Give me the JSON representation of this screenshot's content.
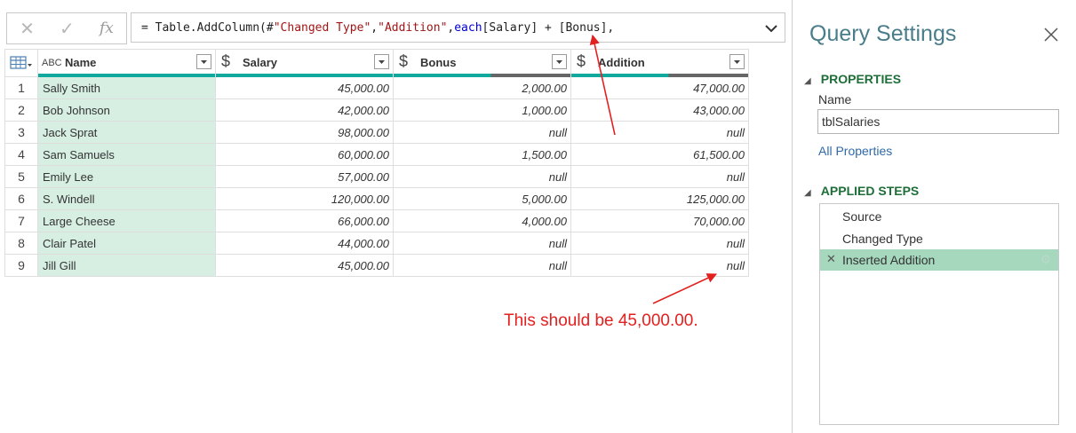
{
  "formula_bar": {
    "cancel_icon": "✕",
    "commit_icon": "✓",
    "fx_label": "fx",
    "parts": {
      "p1": "= Table.AddColumn(#",
      "p2": "\"Changed Type\"",
      "p3": ", ",
      "p4": "\"Addition\"",
      "p5": ", ",
      "p6": "each",
      "p7": " [Salary] + [Bonus],"
    }
  },
  "grid": {
    "columns": {
      "name": {
        "label": "Name",
        "type_icon": "ABC"
      },
      "salary": {
        "label": "Salary",
        "type_icon": "$"
      },
      "bonus": {
        "label": "Bonus",
        "type_icon": "$"
      },
      "addition": {
        "label": "Addition",
        "type_icon": "$"
      }
    },
    "rows": [
      {
        "idx": "1",
        "name": "Sally Smith",
        "salary": "45,000.00",
        "bonus": "2,000.00",
        "addition": "47,000.00"
      },
      {
        "idx": "2",
        "name": "Bob Johnson",
        "salary": "42,000.00",
        "bonus": "1,000.00",
        "addition": "43,000.00"
      },
      {
        "idx": "3",
        "name": "Jack Sprat",
        "salary": "98,000.00",
        "bonus": "null",
        "addition": "null"
      },
      {
        "idx": "4",
        "name": "Sam Samuels",
        "salary": "60,000.00",
        "bonus": "1,500.00",
        "addition": "61,500.00"
      },
      {
        "idx": "5",
        "name": "Emily Lee",
        "salary": "57,000.00",
        "bonus": "null",
        "addition": "null"
      },
      {
        "idx": "6",
        "name": "S. Windell",
        "salary": "120,000.00",
        "bonus": "5,000.00",
        "addition": "125,000.00"
      },
      {
        "idx": "7",
        "name": "Large Cheese",
        "salary": "66,000.00",
        "bonus": "4,000.00",
        "addition": "70,000.00"
      },
      {
        "idx": "8",
        "name": "Clair Patel",
        "salary": "44,000.00",
        "bonus": "null",
        "addition": "null"
      },
      {
        "idx": "9",
        "name": "Jill Gill",
        "salary": "45,000.00",
        "bonus": "null",
        "addition": "null"
      }
    ]
  },
  "annotation": {
    "text": "This should be 45,000.00.",
    "color": "#e32020"
  },
  "query_settings": {
    "title": "Query Settings",
    "properties_header": "PROPERTIES",
    "name_label": "Name",
    "name_value": "tblSalaries",
    "all_properties": "All Properties",
    "applied_steps_header": "APPLIED STEPS",
    "steps": [
      {
        "label": "Source"
      },
      {
        "label": "Changed Type"
      },
      {
        "label": "Inserted Addition",
        "selected": true
      }
    ]
  },
  "colors": {
    "accent_teal": "#11a89d",
    "name_column_bg": "#d7efe3",
    "section_green": "#1e6e38",
    "selected_step_bg": "#a6d8bd",
    "title_color": "#4a7d8a",
    "link_color": "#2f6aa8"
  }
}
